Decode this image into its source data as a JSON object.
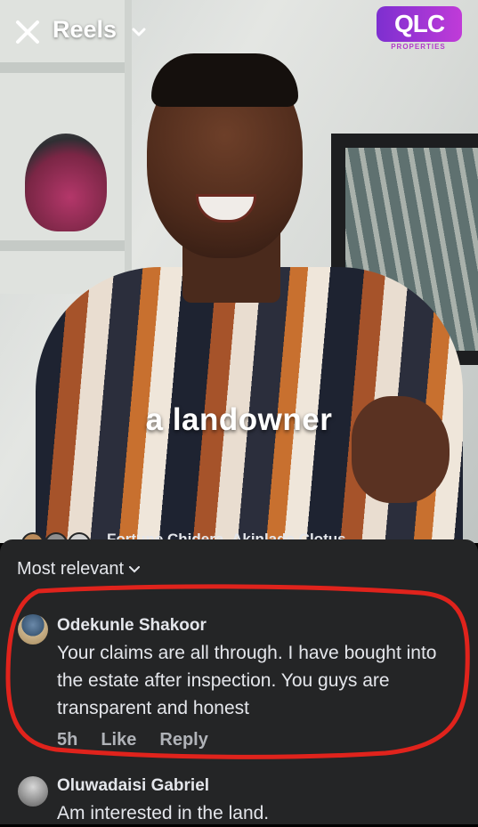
{
  "topbar": {
    "title": "Reels",
    "logo_mark": "QLC",
    "logo_sub": "PROPERTIES"
  },
  "video": {
    "caption": "a landowner"
  },
  "reactions": {
    "names_text": "Fortune Chidera, Akinlade Clotus"
  },
  "comments_panel": {
    "filter_label": "Most relevant",
    "comments": [
      {
        "author": "Odekunle Shakoor",
        "text": "Your claims are all through. I have bought into the estate after inspection. You guys are transparent and honest",
        "time": "5h",
        "like_label": "Like",
        "reply_label": "Reply"
      },
      {
        "author": "Oluwadaisi Gabriel",
        "text": "Am interested in the land."
      }
    ]
  },
  "annotation": {
    "color": "#e0231c"
  }
}
